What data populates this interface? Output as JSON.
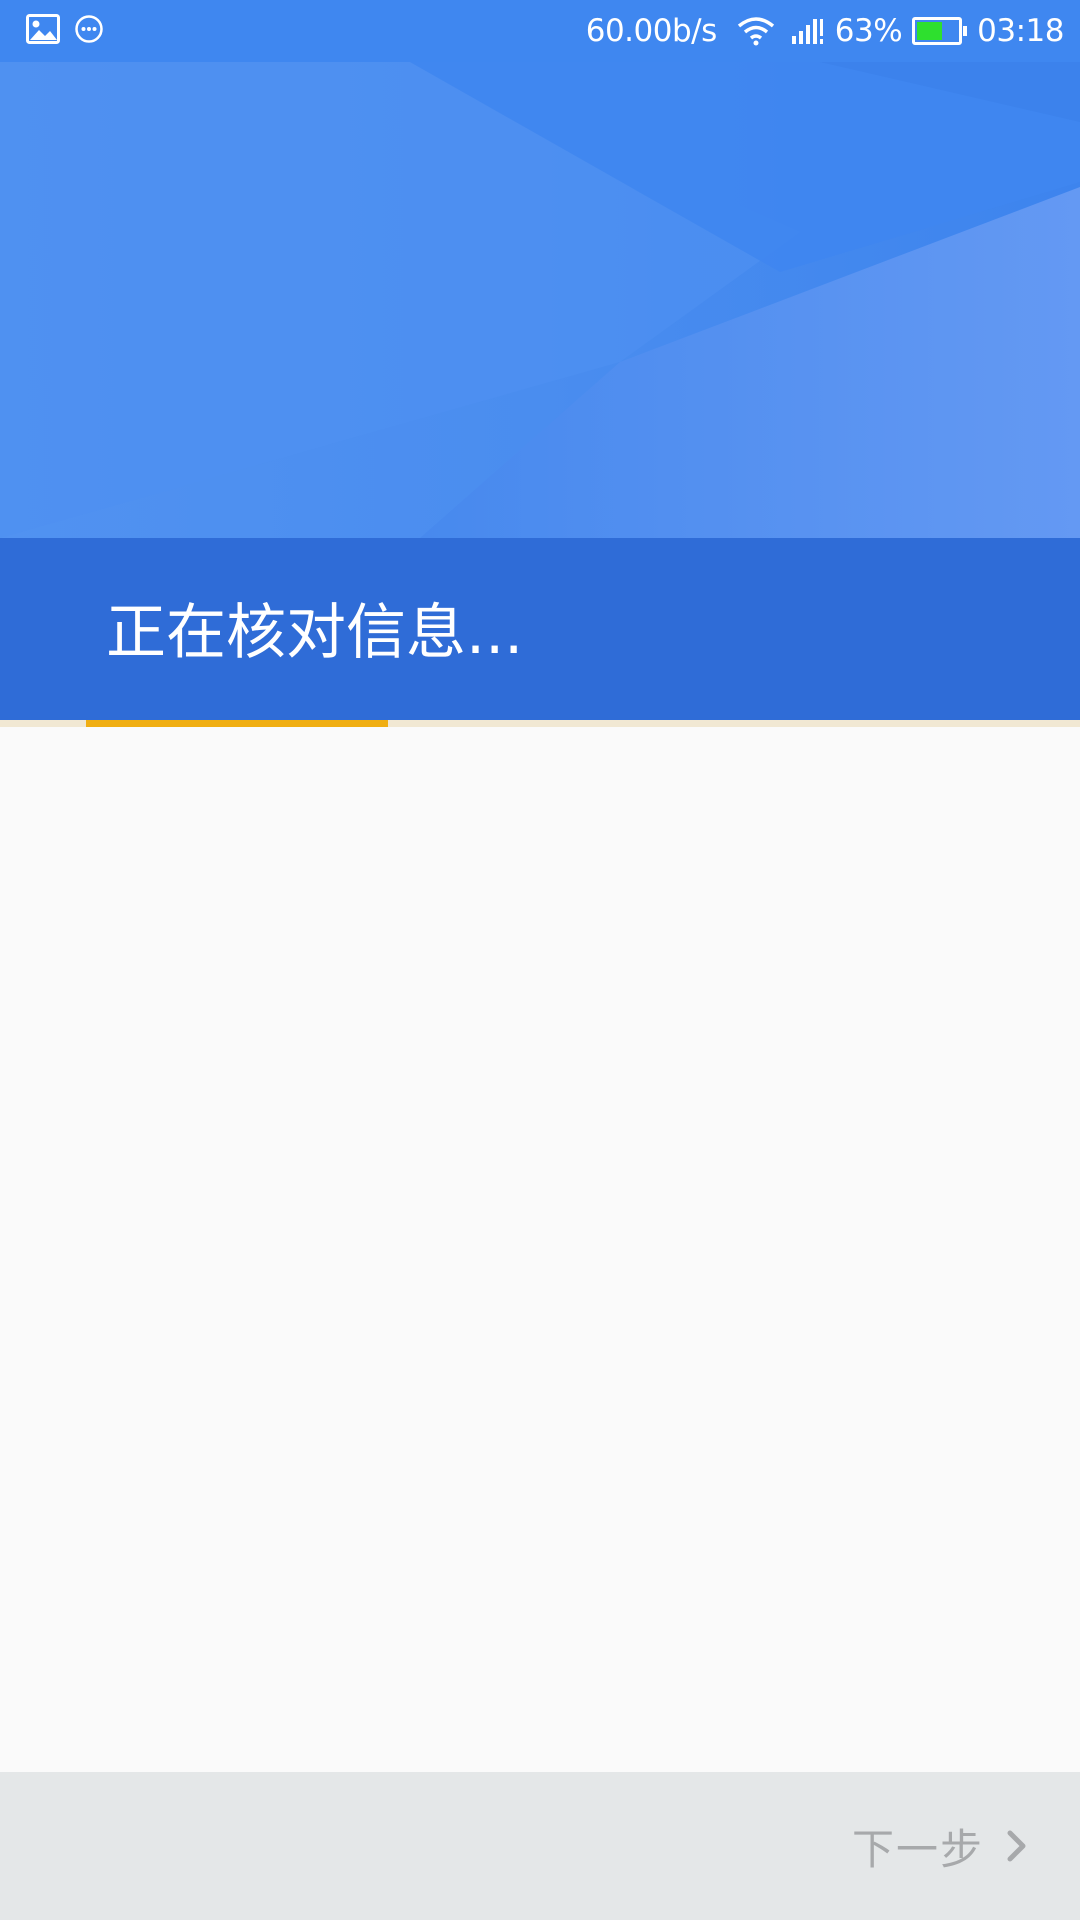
{
  "status_bar": {
    "network_speed": "60.00b/s",
    "battery_percent": "63%",
    "time": "03:18",
    "battery_level": 0.63,
    "icons": [
      "image-icon",
      "message-icon",
      "wifi-icon",
      "signal-icon",
      "battery-icon"
    ]
  },
  "header": {
    "title": "正在核对信息..."
  },
  "progress": {
    "value": 0.28
  },
  "footer": {
    "next_label": "下一步",
    "next_icon": "chevron-right-icon"
  },
  "colors": {
    "primary": "#3f87f0",
    "title_band": "#2f6cd7",
    "progress_accent": "#f0ae12",
    "background": "#fafafa",
    "bottom_bar": "#e4e7e8",
    "disabled_text": "#a7a9ab"
  }
}
